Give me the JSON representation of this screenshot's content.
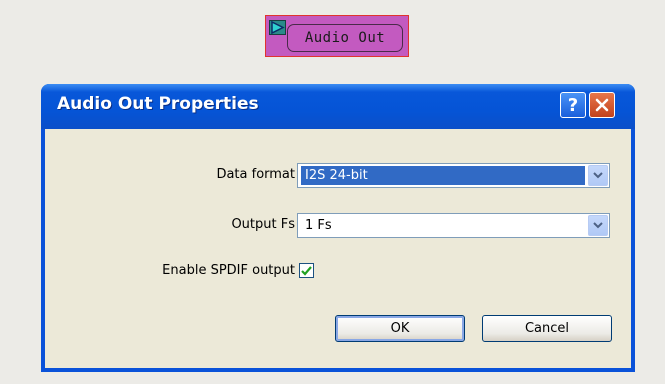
{
  "canvas": {
    "block_label": "Audio Out",
    "port_icon": "play-triangle-icon"
  },
  "dialog": {
    "title": "Audio Out Properties",
    "help_label": "?",
    "close_icon": "close-icon",
    "data_format": {
      "label": "Data format",
      "value": "I2S 24-bit"
    },
    "output_fs": {
      "label": "Output Fs",
      "value": "1 Fs"
    },
    "spdif": {
      "label": "Enable SPDIF output",
      "checked": true
    },
    "ok_label": "OK",
    "cancel_label": "Cancel"
  },
  "colors": {
    "titlebar": "#0554d6",
    "selection": "#316ac5",
    "block_fill": "#c35ac0",
    "block_border": "#e0342f"
  }
}
